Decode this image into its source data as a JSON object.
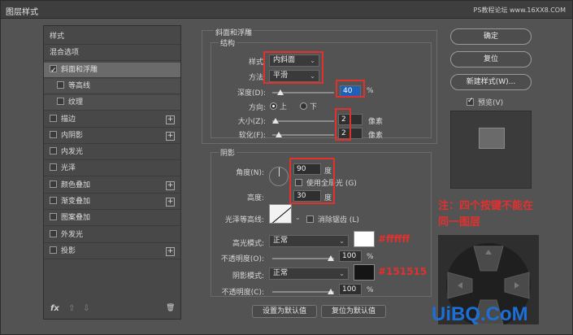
{
  "window": {
    "title": "图层样式",
    "watermark": "PS教程论坛 www.16XX8.COM"
  },
  "left_list": {
    "items": [
      {
        "label": "样式",
        "checkbox": false,
        "plus": false,
        "sub": false,
        "selected": false,
        "checked": false
      },
      {
        "label": "混合选项",
        "checkbox": false,
        "plus": false,
        "sub": false,
        "selected": false,
        "checked": false
      },
      {
        "label": "斜面和浮雕",
        "checkbox": true,
        "plus": false,
        "sub": false,
        "selected": true,
        "checked": true
      },
      {
        "label": "等高线",
        "checkbox": true,
        "plus": false,
        "sub": true,
        "selected": false,
        "checked": false
      },
      {
        "label": "纹理",
        "checkbox": true,
        "plus": false,
        "sub": true,
        "selected": false,
        "checked": false
      },
      {
        "label": "描边",
        "checkbox": true,
        "plus": true,
        "sub": false,
        "selected": false,
        "checked": false
      },
      {
        "label": "内阴影",
        "checkbox": true,
        "plus": true,
        "sub": false,
        "selected": false,
        "checked": false
      },
      {
        "label": "内发光",
        "checkbox": true,
        "plus": false,
        "sub": false,
        "selected": false,
        "checked": false
      },
      {
        "label": "光泽",
        "checkbox": true,
        "plus": false,
        "sub": false,
        "selected": false,
        "checked": false
      },
      {
        "label": "颜色叠加",
        "checkbox": true,
        "plus": true,
        "sub": false,
        "selected": false,
        "checked": false
      },
      {
        "label": "渐变叠加",
        "checkbox": true,
        "plus": true,
        "sub": false,
        "selected": false,
        "checked": false
      },
      {
        "label": "图案叠加",
        "checkbox": true,
        "plus": false,
        "sub": false,
        "selected": false,
        "checked": false
      },
      {
        "label": "外发光",
        "checkbox": true,
        "plus": false,
        "sub": false,
        "selected": false,
        "checked": false
      },
      {
        "label": "投影",
        "checkbox": true,
        "plus": true,
        "sub": false,
        "selected": false,
        "checked": false
      }
    ],
    "footer": {
      "fx": "fx",
      "up": "⇧",
      "down": "⇩",
      "trash": "🗑"
    }
  },
  "bevel": {
    "section_title": "斜面和浮雕",
    "structure_title": "结构",
    "style_label": "样式:",
    "style_value": "内斜面",
    "method_label": "方法:",
    "method_value": "平滑",
    "depth_label": "深度(D):",
    "depth_value": "40",
    "depth_unit": "%",
    "direction_label": "方向:",
    "dir_up": "上",
    "dir_down": "下",
    "size_label": "大小(Z):",
    "size_value": "2",
    "size_unit": "像素",
    "soften_label": "软化(F):",
    "soften_value": "2",
    "soften_unit": "像素"
  },
  "shading": {
    "title": "阴影",
    "angle_label": "角度(N):",
    "angle_value": "90",
    "angle_unit": "度",
    "global_light_label": "使用全局光 (G)",
    "altitude_label": "高度:",
    "altitude_value": "30",
    "altitude_unit": "度",
    "gloss_label": "光泽等高线:",
    "anti_alias_label": "消除锯齿 (L)",
    "highlight_mode_label": "高光模式:",
    "highlight_mode_value": "正常",
    "highlight_color": "#ffffff",
    "highlight_annot": "#ffffff",
    "opacity1_label": "不透明度(O):",
    "opacity1_value": "100",
    "opacity1_unit": "%",
    "shadow_mode_label": "阴影模式:",
    "shadow_mode_value": "正常",
    "shadow_color": "#151515",
    "shadow_annot": "#151515",
    "opacity2_label": "不透明度(C):",
    "opacity2_value": "100",
    "opacity2_unit": "%"
  },
  "bottom_buttons": {
    "set_default": "设置为默认值",
    "reset_default": "复位为默认值"
  },
  "right": {
    "ok": "确定",
    "reset": "复位",
    "new_style": "新建样式(W)...",
    "preview_label": "预览(V)",
    "note": "注：四个按键不能在同一图层"
  },
  "logo": "UiBQ.CoM",
  "colors": {
    "accent_red": "#e0312f",
    "panel_bg": "#535353"
  }
}
